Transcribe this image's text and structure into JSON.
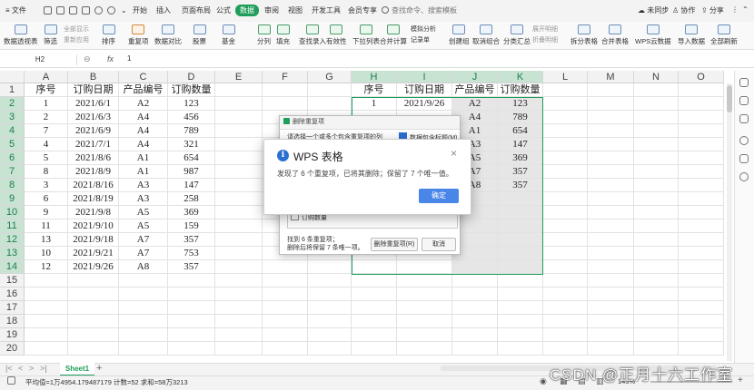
{
  "menubar": {
    "file": "文件",
    "tabs": [
      "开始",
      "插入",
      "页面布局",
      "公式",
      "数据",
      "审阅",
      "视图",
      "开发工具",
      "会员专享"
    ],
    "active_tab": "数据",
    "search_placeholder": "查找命令、搜索模板",
    "sync": "未同步",
    "collab": "协作",
    "share": "分享"
  },
  "ribbon": {
    "buttons": [
      "数据透视表",
      "筛选",
      "排序",
      "重复项",
      "数据对比",
      "股票",
      "基金",
      "分列",
      "填充",
      "查找录入",
      "有效性",
      "下拉列表",
      "合并计算",
      "记录单",
      "创建组",
      "取消组合",
      "分类汇总",
      "拆分表格",
      "合并表格",
      "WPS云数据",
      "导入数据",
      "全部刷新"
    ],
    "small": [
      "全部显示",
      "重新应用",
      "模拟分析",
      "展开明细",
      "折叠明细"
    ]
  },
  "formula_bar": {
    "cell_ref": "H2",
    "fx": "fx",
    "value": "1"
  },
  "grid": {
    "columns": [
      "A",
      "B",
      "C",
      "D",
      "E",
      "F",
      "G",
      "H",
      "I",
      "J",
      "K",
      "L",
      "M",
      "N",
      "O"
    ],
    "rows": [
      "1",
      "2",
      "3",
      "4",
      "5",
      "6",
      "7",
      "8",
      "9",
      "10",
      "11",
      "12",
      "13",
      "14",
      "15",
      "16",
      "17",
      "18",
      "19",
      "20"
    ],
    "left_header": [
      "序号",
      "订购日期",
      "产品编号",
      "订购数量"
    ],
    "left_data": [
      [
        "1",
        "2021/6/1",
        "A2",
        "123"
      ],
      [
        "2",
        "2021/6/3",
        "A4",
        "456"
      ],
      [
        "7",
        "2021/6/9",
        "A4",
        "789"
      ],
      [
        "4",
        "2021/7/1",
        "A4",
        "321"
      ],
      [
        "5",
        "2021/8/6",
        "A1",
        "654"
      ],
      [
        "8",
        "2021/8/9",
        "A1",
        "987"
      ],
      [
        "3",
        "2021/8/16",
        "A3",
        "147"
      ],
      [
        "6",
        "2021/8/19",
        "A3",
        "258"
      ],
      [
        "9",
        "2021/9/8",
        "A5",
        "369"
      ],
      [
        "11",
        "2021/9/10",
        "A5",
        "159"
      ],
      [
        "13",
        "2021/9/18",
        "A7",
        "357"
      ],
      [
        "10",
        "2021/9/21",
        "A7",
        "753"
      ],
      [
        "12",
        "2021/9/26",
        "A8",
        "357"
      ]
    ],
    "right_header": [
      "序号",
      "订购日期",
      "产品编号",
      "订购数量"
    ],
    "right_row1": [
      "1",
      "2021/9/26",
      "A2",
      "123"
    ],
    "right_jk": [
      [
        "A4",
        "789"
      ],
      [
        "A1",
        "654"
      ],
      [
        "A3",
        "147"
      ],
      [
        "A5",
        "369"
      ],
      [
        "A7",
        "357"
      ],
      [
        "A8",
        "357"
      ]
    ]
  },
  "back_dialog": {
    "title": "删除重复项",
    "prompt": "请选择一个或多个包含重复项的列",
    "header_check": "数据包含标题(M)",
    "list_item": "订购数量",
    "info_line1": "找到 6 条重复项；",
    "info_line2": "删除后将保留 7 条唯一项。",
    "delete_button": "删除重复项(R)",
    "cancel_button": "取消"
  },
  "front_dialog": {
    "title": "WPS 表格",
    "message": "发现了 6 个重复项，已将其删除；保留了 7 个唯一值。",
    "ok": "确定",
    "close": "×",
    "info_glyph": "i"
  },
  "sheet": {
    "tab": "Sheet1",
    "add": "+"
  },
  "status": {
    "summary": "平均值=1万4954.179487179  计数=52  求和=58万3213",
    "zoom": "145%"
  },
  "watermark": "CSDN @正月十六工作室",
  "colors": {
    "accent": "#1e9e5a",
    "primary_button": "#4a86e8",
    "info_icon": "#2b6fd1"
  }
}
